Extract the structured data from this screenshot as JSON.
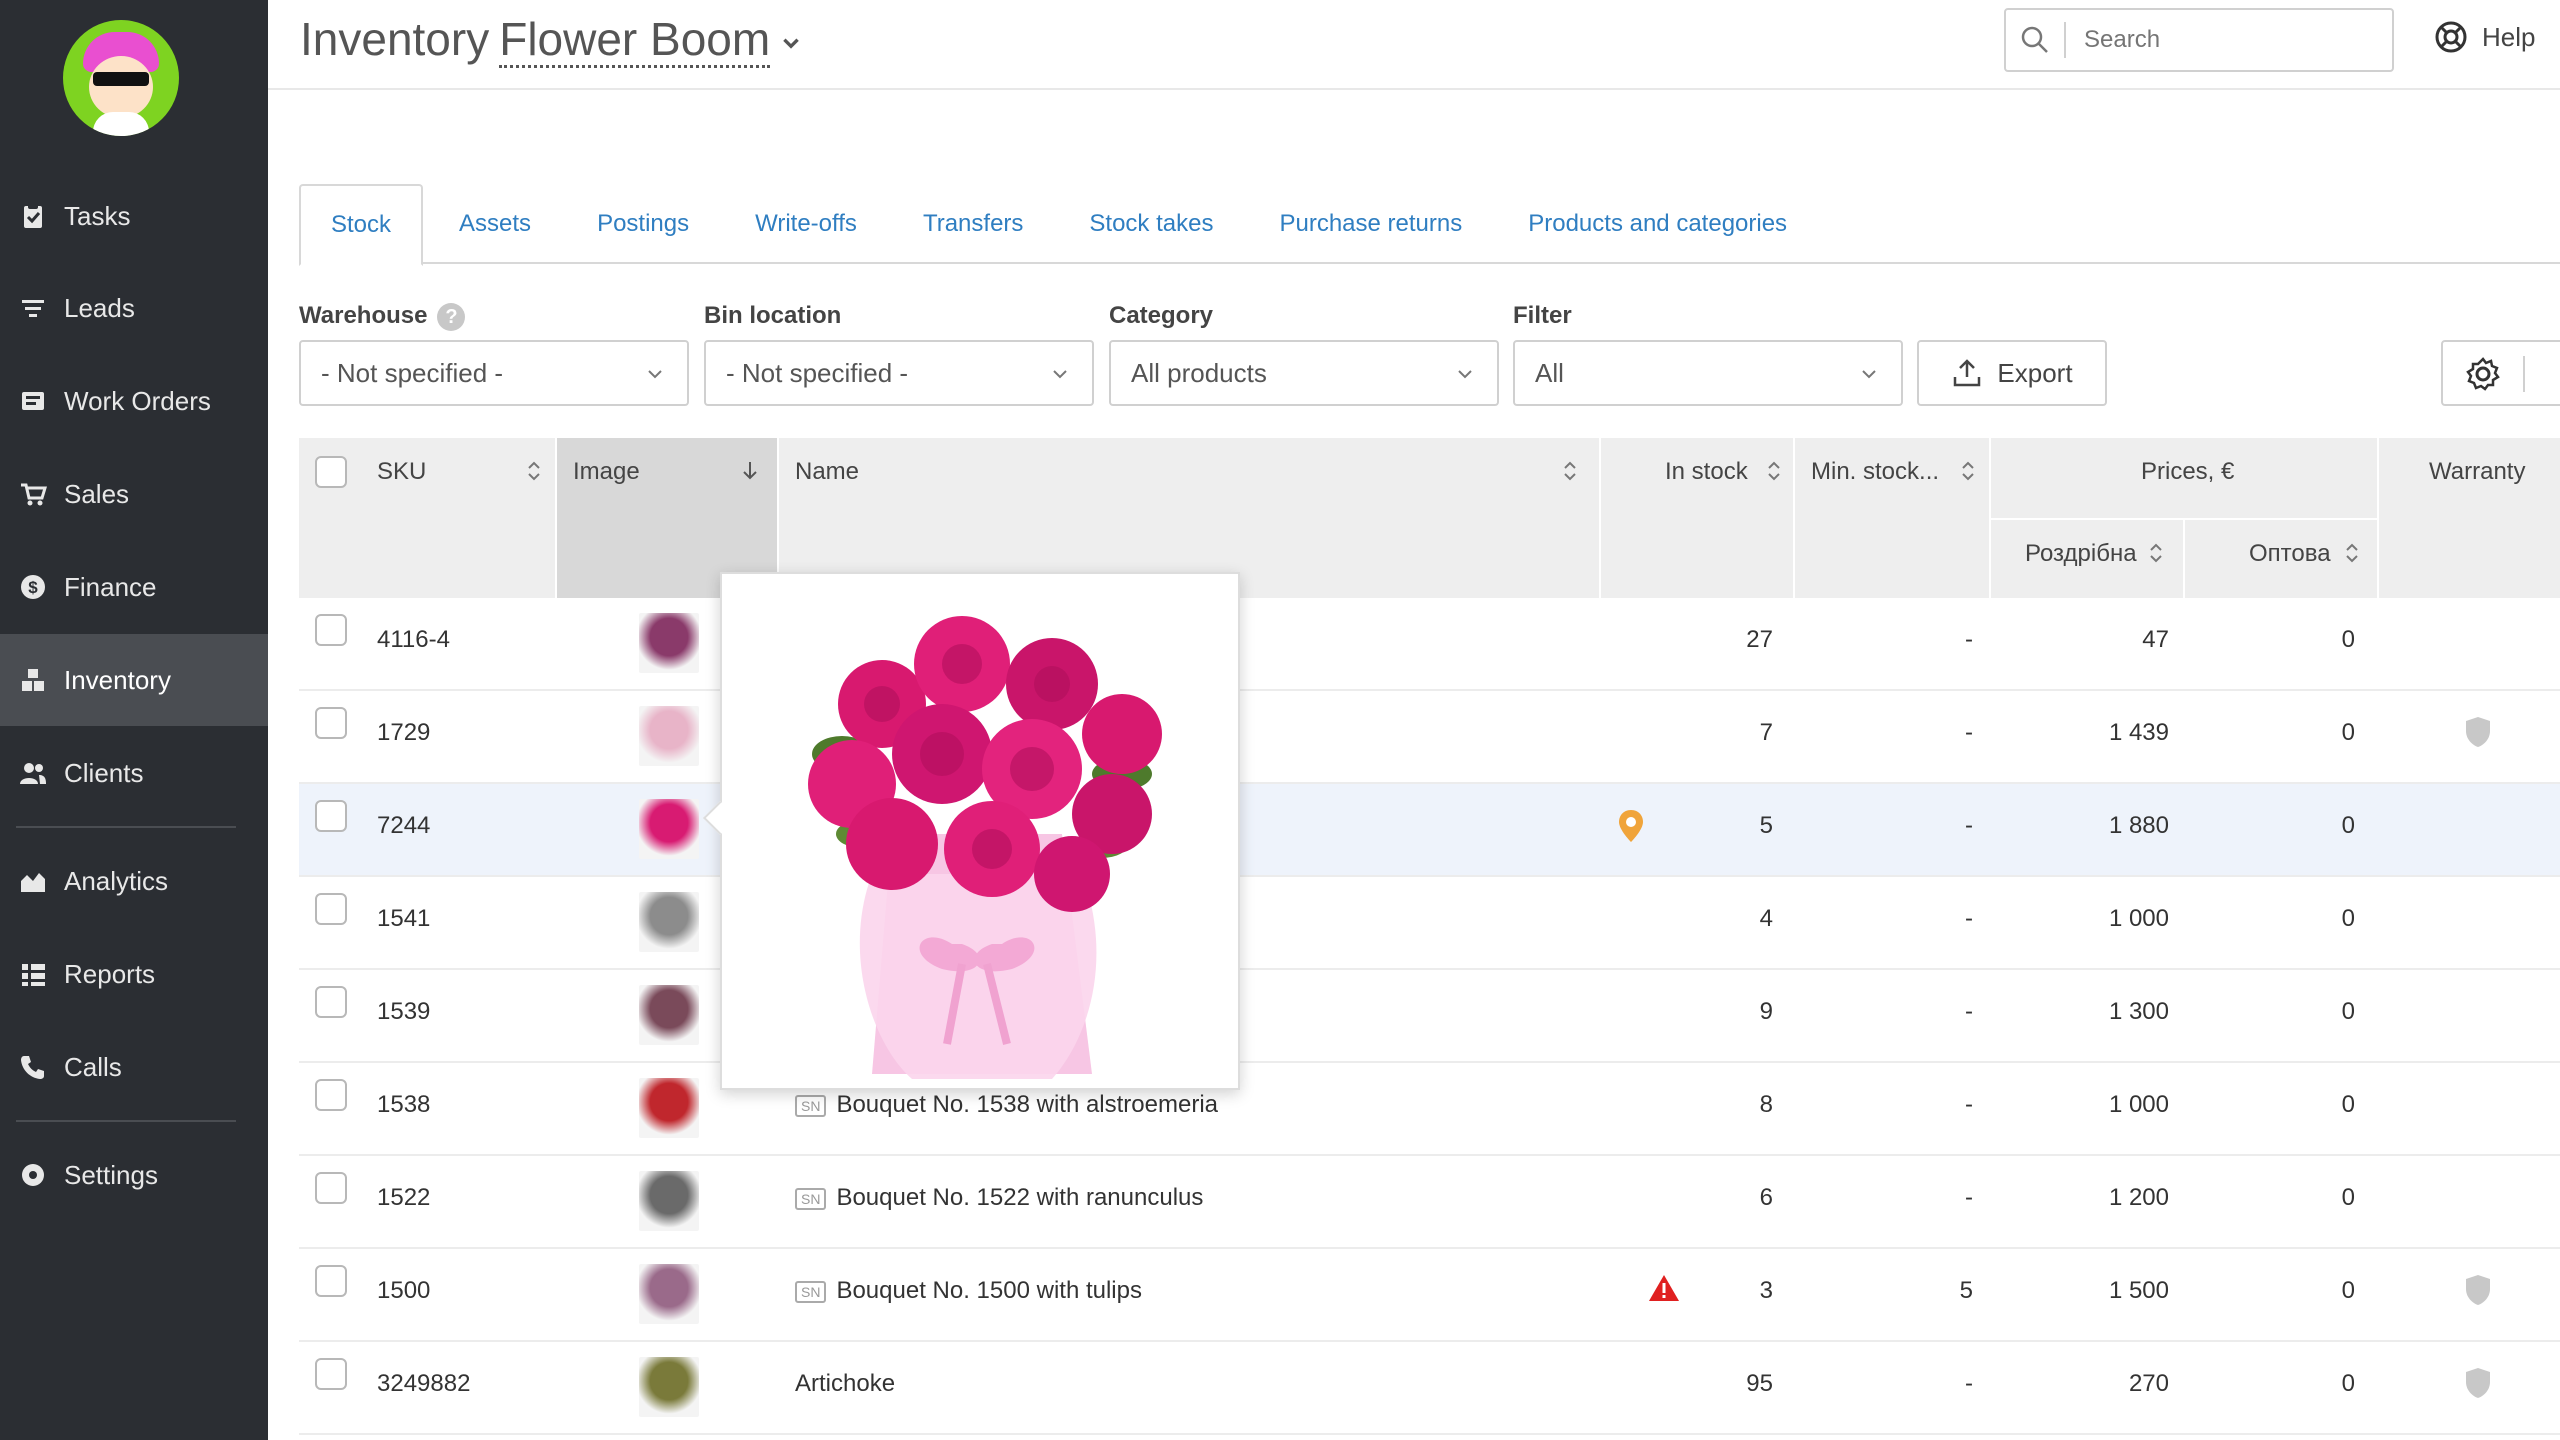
{
  "sidebar": {
    "items": [
      {
        "label": "Tasks",
        "icon": "clipboard-icon"
      },
      {
        "label": "Leads",
        "icon": "funnel-icon"
      },
      {
        "label": "Work Orders",
        "icon": "wrench-icon"
      },
      {
        "label": "Sales",
        "icon": "cart-icon"
      },
      {
        "label": "Finance",
        "icon": "dollar-icon"
      },
      {
        "label": "Inventory",
        "icon": "boxes-icon"
      },
      {
        "label": "Clients",
        "icon": "users-icon"
      },
      {
        "label": "Analytics",
        "icon": "chart-icon"
      },
      {
        "label": "Reports",
        "icon": "list-icon"
      },
      {
        "label": "Calls",
        "icon": "phone-icon"
      },
      {
        "label": "Settings",
        "icon": "gear-icon"
      }
    ],
    "active": "Inventory"
  },
  "header": {
    "title": "Inventory",
    "warehouse": "Flower Boom",
    "search_placeholder": "Search",
    "help_label": "Help"
  },
  "tabs": [
    {
      "label": "Stock",
      "active": true
    },
    {
      "label": "Assets"
    },
    {
      "label": "Postings"
    },
    {
      "label": "Write-offs"
    },
    {
      "label": "Transfers"
    },
    {
      "label": "Stock takes"
    },
    {
      "label": "Purchase returns"
    },
    {
      "label": "Products and categories"
    }
  ],
  "filters": {
    "warehouse_label": "Warehouse",
    "warehouse_value": "- Not specified -",
    "bin_label": "Bin location",
    "bin_value": "- Not specified -",
    "category_label": "Category",
    "category_value": "All products",
    "filter_label": "Filter",
    "filter_value": "All",
    "export_label": "Export"
  },
  "columns": {
    "sku": "SKU",
    "image": "Image",
    "name": "Name",
    "in_stock": "In stock",
    "min_stock": "Min. stock...",
    "prices": "Prices, €",
    "retail": "Роздрібна",
    "wholesale": "Оптова",
    "warranty": "Warranty"
  },
  "rows": [
    {
      "sku": "4116-4",
      "name": "",
      "in_stock": "27",
      "min_stock": "-",
      "retail": "47",
      "wholesale": "0",
      "warranty": false,
      "sn": false,
      "marker": "",
      "thumb": "#8a3a6a"
    },
    {
      "sku": "1729",
      "name": "",
      "in_stock": "7",
      "min_stock": "-",
      "retail": "1 439",
      "wholesale": "0",
      "warranty": true,
      "sn": false,
      "marker": "",
      "thumb": "#e8b4c8"
    },
    {
      "sku": "7244",
      "name": "",
      "in_stock": "5",
      "min_stock": "-",
      "retail": "1 880",
      "wholesale": "0",
      "warranty": false,
      "sn": false,
      "marker": "pin",
      "thumb": "#d81b72"
    },
    {
      "sku": "1541",
      "name": "",
      "in_stock": "4",
      "min_stock": "-",
      "retail": "1 000",
      "wholesale": "0",
      "warranty": false,
      "sn": false,
      "marker": "",
      "thumb": "#8c8c8c"
    },
    {
      "sku": "1539",
      "name": "",
      "in_stock": "9",
      "min_stock": "-",
      "retail": "1 300",
      "wholesale": "0",
      "warranty": false,
      "sn": false,
      "marker": "",
      "thumb": "#7a4a5a"
    },
    {
      "sku": "1538",
      "name": "Bouquet No. 1538 with alstroemeria",
      "in_stock": "8",
      "min_stock": "-",
      "retail": "1 000",
      "wholesale": "0",
      "warranty": false,
      "sn": true,
      "marker": "",
      "thumb": "#c0272d"
    },
    {
      "sku": "1522",
      "name": "Bouquet No. 1522 with ranunculus",
      "in_stock": "6",
      "min_stock": "-",
      "retail": "1 200",
      "wholesale": "0",
      "warranty": false,
      "sn": true,
      "marker": "",
      "thumb": "#6a6a6a"
    },
    {
      "sku": "1500",
      "name": "Bouquet No. 1500 with tulips",
      "in_stock": "3",
      "min_stock": "5",
      "retail": "1 500",
      "wholesale": "0",
      "warranty": true,
      "sn": true,
      "marker": "warning",
      "thumb": "#9a6a8a"
    },
    {
      "sku": "3249882",
      "name": "Artichoke",
      "in_stock": "95",
      "min_stock": "-",
      "retail": "270",
      "wholesale": "0",
      "warranty": true,
      "sn": false,
      "marker": "",
      "thumb": "#7a7a3a"
    }
  ],
  "sn_badge": "SN",
  "colors": {
    "sidebar_bg": "#2b2e33",
    "link_blue": "#2f7ec1",
    "pin_orange": "#f0a43a",
    "warning_red": "#e02020"
  }
}
